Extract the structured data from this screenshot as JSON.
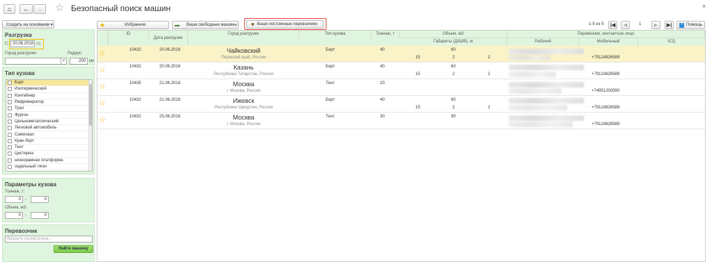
{
  "window": {
    "title": "Безопасный поиск машин",
    "close": "×"
  },
  "toolbar": {
    "create": "Создать на основании ▾",
    "favorites": "Избранное",
    "free_cars": "Ваши свободные машины",
    "regular_carriers": "Ваши постоянные перевозчики"
  },
  "pager": {
    "range": "1-5 из 5",
    "page": "1",
    "help": "Помощь"
  },
  "sidebar": {
    "unload": {
      "title": "Разгрузка",
      "from_label": "С:",
      "from_value": "20.06.2018",
      "city_label": "Город разгрузки:",
      "radius_label": "Радиус:",
      "radius_value": "200",
      "radius_unit": "км",
      "clear": "×"
    },
    "body": {
      "title": "Тип кузова",
      "items": [
        "Борт",
        "Изотермический",
        "Контейнер",
        "Рефрижератор",
        "Трал",
        "Фургон",
        "Цельнометаллический",
        "Легковой автомобиль",
        "Самосвал",
        "Кран-борт",
        "Тент",
        "Цистерна",
        "низкорамная платформа",
        "седельный тягач"
      ]
    },
    "params": {
      "title": "Параметры кузова",
      "tonnage_label": "Тоннаж, т:",
      "volume_label": "Объем, м3:",
      "t_from": "0",
      "t_to": "0",
      "v_from": "0",
      "v_to": "0",
      "dash": "-"
    },
    "carrier": {
      "title": "Перевозчик",
      "placeholder": "Введите перевозчика..."
    },
    "find": "Найти машину"
  },
  "table": {
    "headers": {
      "id": "ID",
      "date": "Дата разгрузки",
      "city": "Город разгрузки",
      "body": "Тип кузова",
      "tonnage": "Тоннаж, т",
      "volume": "Объем, м3",
      "dims": "Габариты (Д/Ш/В), м",
      "carrier": "Перевозчик, контактное лицо",
      "work": "Рабочий",
      "mobile": "Мобильный",
      "icq": "ICQ"
    },
    "rows": [
      {
        "id": "10432",
        "date": "20.06.2018",
        "city": "Чайковский",
        "region": "Пермский край, Россия",
        "body": "Борт",
        "tonnage": "40",
        "volume": "60",
        "l": "15",
        "w": "2",
        "h": "2",
        "phone": "+79124826589"
      },
      {
        "id": "10432",
        "date": "20.06.2018",
        "city": "Казань",
        "region": "Республика Татарстан, Россия",
        "body": "Борт",
        "tonnage": "40",
        "volume": "60",
        "l": "15",
        "w": "2",
        "h": "2",
        "phone": "+79124826589"
      },
      {
        "id": "10435",
        "date": "21.06.2018",
        "city": "Москва",
        "region": "г. Москва, Россия",
        "body": "Тент",
        "tonnage": "20",
        "volume": "",
        "l": "",
        "w": "",
        "h": "",
        "phone": "+74951200590"
      },
      {
        "id": "10432",
        "date": "21.06.2018",
        "city": "Ижевск",
        "region": "Республика Удмуртия, Россия",
        "body": "Борт",
        "tonnage": "40",
        "volume": "60",
        "l": "15",
        "w": "2",
        "h": "2",
        "phone": "+79124826589"
      },
      {
        "id": "10432",
        "date": "25.06.2018",
        "city": "Москва",
        "region": "г. Москва, Россия",
        "body": "Тент",
        "tonnage": "30",
        "volume": "90",
        "l": "",
        "w": "",
        "h": "",
        "phone": "+79124826589"
      }
    ]
  },
  "colors": {
    "accent": "#e0f5df",
    "selected": "#fbf3c8",
    "highlight": "#e0463c",
    "star": "#f0b400",
    "primary_button": "#8fd85a"
  }
}
